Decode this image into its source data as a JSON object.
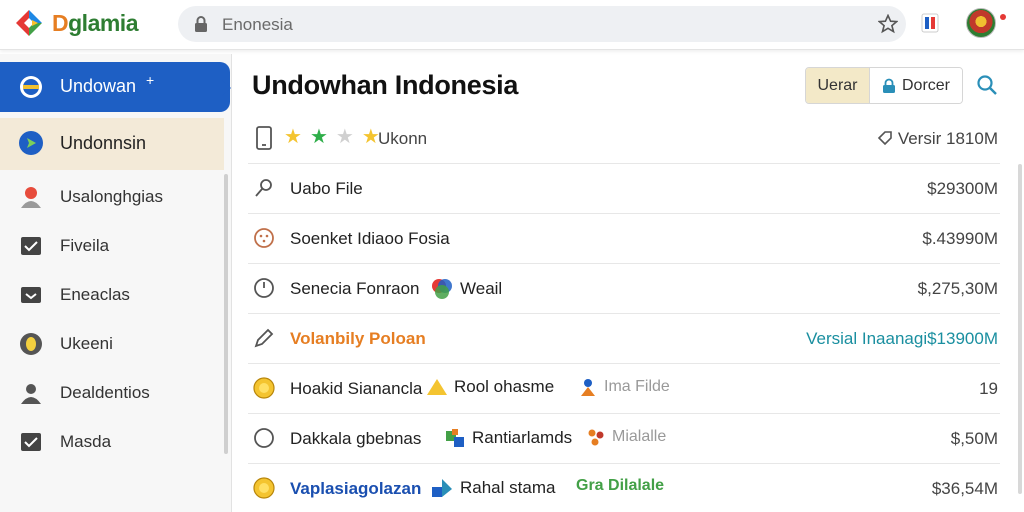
{
  "app": {
    "logo_text": "glamia",
    "url_text": "Enonesia",
    "colors": {
      "accent": "#1e5fc4",
      "highlight_bg": "#f3ead8",
      "orange": "#e67e22",
      "teal": "#1a8fa0",
      "blue_text": "#1a4fb0"
    }
  },
  "sidebar": {
    "items": [
      {
        "label": "Undowan",
        "icon": "globe-icon",
        "suffix": "+"
      },
      {
        "label": "Undonnsin",
        "icon": "compass-icon"
      },
      {
        "label": "Usalonghgias",
        "icon": "user-icon"
      },
      {
        "label": "Fiveila",
        "icon": "check-box-icon"
      },
      {
        "label": "Eneaclas",
        "icon": "inbox-icon"
      },
      {
        "label": "Ukeeni",
        "icon": "lemon-icon"
      },
      {
        "label": "Dealdentios",
        "icon": "person-icon"
      },
      {
        "label": "Masda",
        "icon": "check-box-icon"
      }
    ]
  },
  "main": {
    "title": "Undowhan Indonesia",
    "toggle": {
      "a": "Uerar",
      "b": "Dorcer"
    },
    "header_row": {
      "label": "Ukonn",
      "right": "Versir 1810M",
      "rating": 3
    },
    "rows": [
      {
        "name": "Uabo File",
        "right": "$29300M",
        "icon": "pin-icon"
      },
      {
        "name": "Soenket Idiaoo Fosia",
        "right": "$.43990M",
        "icon": "smiley-icon"
      },
      {
        "name": "Senecia Fonraon",
        "mid": "Weail",
        "right": "$,275,30M",
        "icon": "clock-icon"
      },
      {
        "name": "Volanbily Poloan",
        "right": "Versial Inaanagi$13900M",
        "icon": "pencil-icon"
      },
      {
        "name": "Hoakid Sianancla",
        "mid": "Rool ohasme",
        "mid2": "Ima Filde",
        "right": "19",
        "icon": "coin-icon"
      },
      {
        "name": "Dakkala gbebnas",
        "mid": "Rantiarlamds",
        "mid2": "Mialalle",
        "right": "$,50M",
        "icon": "circle-icon"
      },
      {
        "name": "Vaplasiagolazan",
        "mid": "Rahal stama",
        "mid2": "Gra Dilalale",
        "right": "$36,54M",
        "icon": "coin-icon"
      }
    ]
  }
}
